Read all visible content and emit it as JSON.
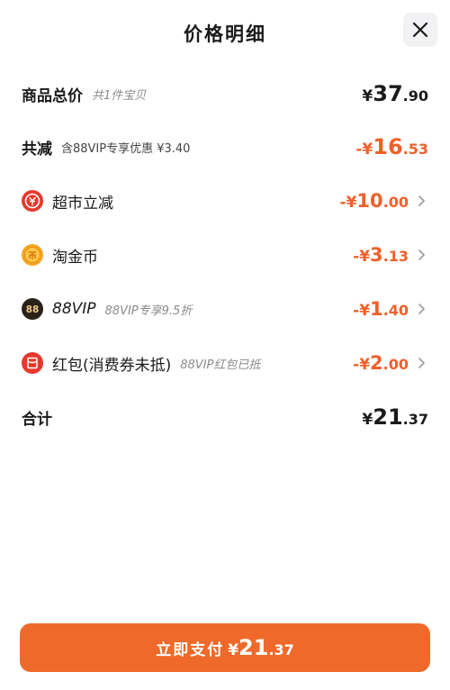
{
  "header": {
    "title": "价格明细",
    "close_icon": "close-icon"
  },
  "items": {
    "subtotal": {
      "label": "商品总价",
      "sub": "共1件宝贝",
      "sign": "¥",
      "int": "37",
      "dec": ".90"
    },
    "total_discount": {
      "label": "共减",
      "sub": "含88VIP专享优惠 ¥3.40",
      "sign": "-¥",
      "int": "16",
      "dec": ".53"
    },
    "supermarket": {
      "label": "超市立减",
      "sign": "-¥",
      "int": "10",
      "dec": ".00",
      "icon": "supermarket-discount-icon"
    },
    "taojin": {
      "label": "淘金币",
      "sign": "-¥",
      "int": "3",
      "dec": ".13",
      "icon": "coin-icon"
    },
    "vip": {
      "label": "88VIP",
      "sub": "88VIP专享9.5折",
      "sign": "-¥",
      "int": "1",
      "dec": ".40",
      "icon": "vip-88-icon"
    },
    "redpacket": {
      "label": "红包(消费券未抵)",
      "sub": "88VIP红包已抵",
      "sign": "-¥",
      "int": "2",
      "dec": ".00",
      "icon": "red-packet-icon"
    },
    "total": {
      "label": "合计",
      "sign": "¥",
      "int": "21",
      "dec": ".37"
    }
  },
  "pay_button": {
    "label": "立即支付",
    "sign": "¥",
    "int": "21",
    "dec": ".37"
  },
  "colors": {
    "accent": "#ef6a2a",
    "discount": "#f0602a",
    "text": "#1a1a1a",
    "muted": "#8a8a8a"
  }
}
